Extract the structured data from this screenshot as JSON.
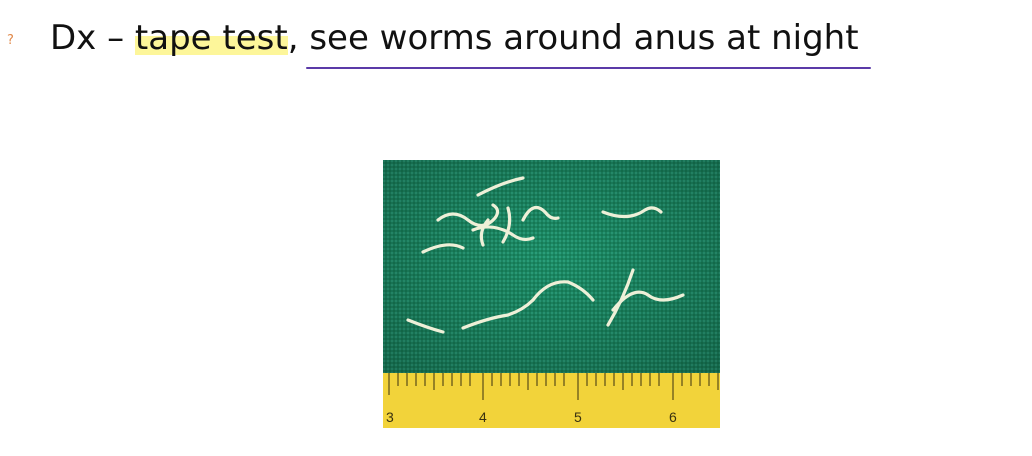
{
  "slide": {
    "bullet": {
      "glyph": "?",
      "text_prefix": "Dx – ",
      "highlighted_text": "tape test",
      "text_suffix": ", see worms around anus at night"
    },
    "figure": {
      "description_icon": "pinworms-on-tape-photo-icon",
      "ruler_labels": [
        "3",
        "4",
        "5",
        "6"
      ]
    },
    "colors": {
      "bullet_glyph": "#e0894a",
      "highlight": "#fdf69a",
      "underline": "#5b3aa8",
      "fabric_green": "#1f8f6a",
      "ruler_yellow": "#f2d33a"
    }
  }
}
